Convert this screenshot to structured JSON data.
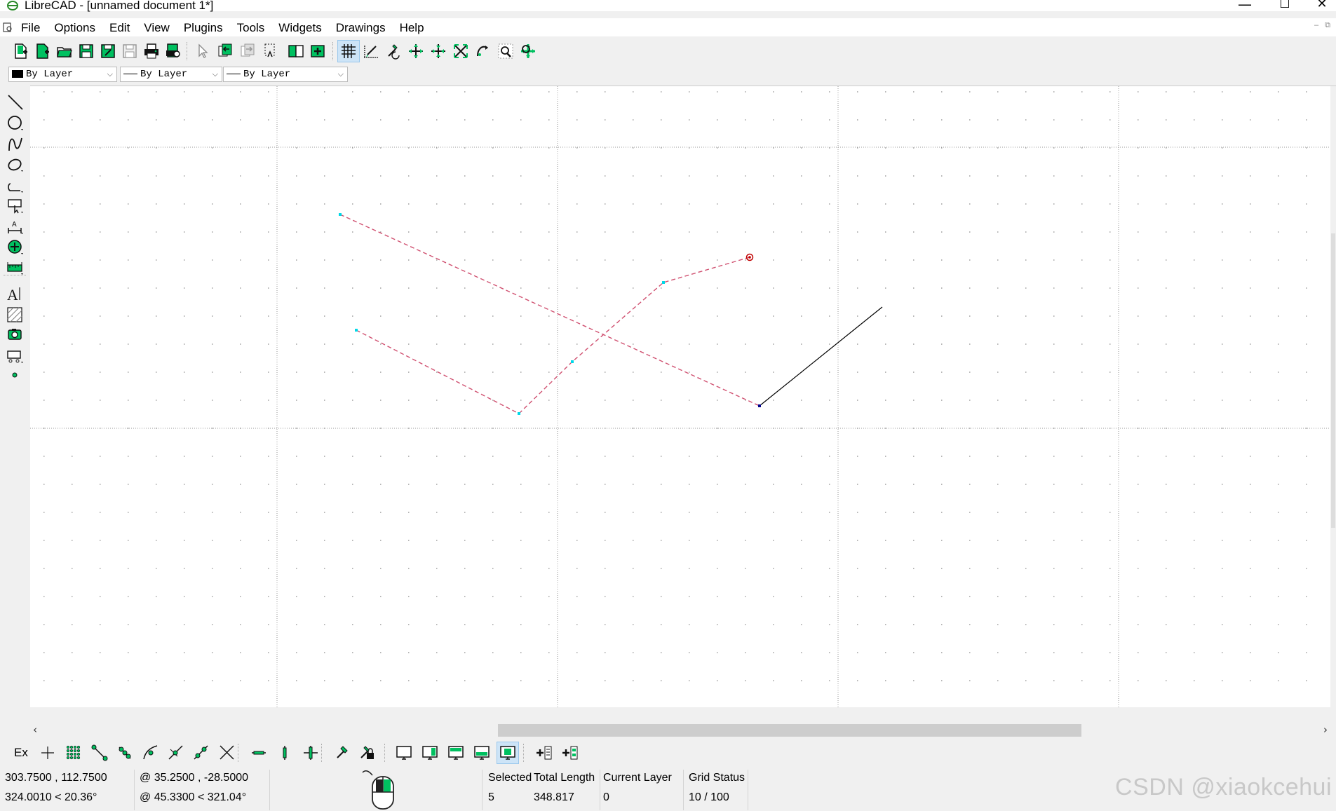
{
  "window": {
    "title": "LibreCAD - [unnamed document 1*]",
    "controls": {
      "minimize": "—",
      "maximize": "☐",
      "close": "✕"
    }
  },
  "menubar": {
    "items": [
      "File",
      "Options",
      "Edit",
      "View",
      "Plugins",
      "Tools",
      "Widgets",
      "Drawings",
      "Help"
    ]
  },
  "toolbar": {
    "file_buttons": [
      "new-file-icon",
      "new-from-template-icon",
      "open-file-icon",
      "save-icon",
      "save-as-icon",
      "save-all-icon",
      "print-icon",
      "print-preview-icon"
    ],
    "edit_buttons": [
      "select-pointer-icon",
      "undo-icon",
      "redo-icon",
      "cut-icon",
      "copy-icon",
      "paste-icon"
    ],
    "view_buttons": [
      "grid-icon",
      "draft-mode-icon",
      "redraw-icon",
      "zoom-in-icon",
      "zoom-out-icon",
      "zoom-auto-icon",
      "zoom-previous-icon",
      "zoom-window-icon",
      "zoom-pan-icon"
    ],
    "grid_active": true
  },
  "pen": {
    "color": "By Layer",
    "width": "By Layer",
    "linetype": "By Layer"
  },
  "left_toolbar": [
    "line-tool-icon",
    "circle-tool-icon",
    "spline-tool-icon",
    "ellipse-tool-icon",
    "polyline-tool-icon",
    "select-tool-icon",
    "dimension-tool-icon",
    "modify-tool-icon",
    "info-tool-icon",
    "text-tool-icon",
    "hatch-tool-icon",
    "image-tool-icon",
    "block-tool-icon",
    "point-tool-icon"
  ],
  "snap_toolbar": {
    "ex_label": "Ex",
    "buttons": [
      "snap-free-icon",
      "snap-grid-icon",
      "snap-endpoint-icon",
      "snap-on-entity-icon",
      "snap-center-icon",
      "snap-middle-icon",
      "snap-distance-icon",
      "snap-intersection-icon",
      "restrict-horizontal-icon",
      "restrict-vertical-icon",
      "restrict-ortho-icon",
      "relative-zero-icon",
      "lock-relative-zero-icon",
      "view-1-icon",
      "view-2-icon",
      "view-3-icon",
      "view-4-icon",
      "view-5-icon",
      "add-layer-icon",
      "add-block-icon"
    ]
  },
  "status": {
    "abs_coords": "303.7500 , 112.7500",
    "abs_polar": "324.0010 < 20.36°",
    "rel_coords": "@  35.2500 , -28.5000",
    "rel_polar": "@  45.3300 < 321.04°",
    "selected_label": "Selected",
    "selected_value": "5",
    "length_label": "Total Length",
    "length_value": "348.817",
    "layer_label": "Current Layer",
    "layer_value": "0",
    "grid_label": "Grid Status",
    "grid_value": "10 / 100"
  },
  "watermark": "CSDN @xiaokcehui",
  "colors": {
    "selected_line": "#d05070",
    "handle": "#00d8e8",
    "active_endpoint": "#c00000",
    "normal_line": "#000000",
    "grid_dot": "#a0a0a0",
    "icon_green": "#00c060",
    "icon_dark": "#111111"
  }
}
